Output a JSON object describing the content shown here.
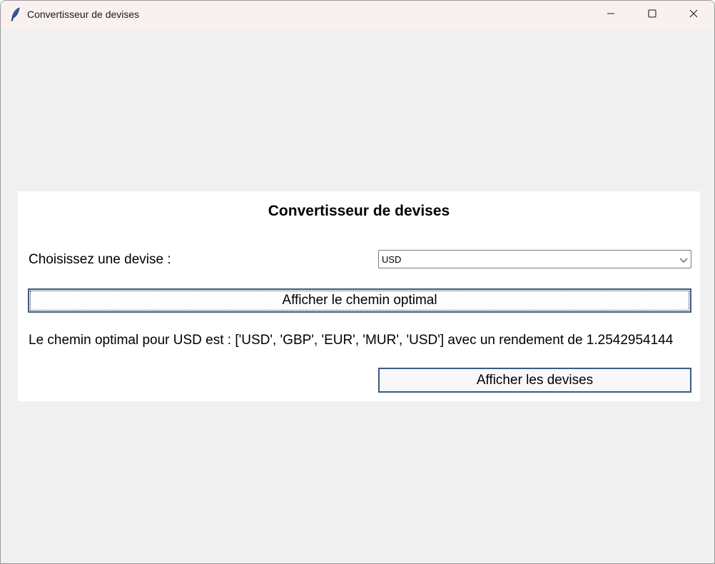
{
  "window": {
    "title": "Convertisseur de devises",
    "app_icon": "feather-icon",
    "controls": [
      "minimize-icon",
      "maximize-icon",
      "close-icon"
    ]
  },
  "main": {
    "heading": "Convertisseur de devises",
    "currency_label": "Choisissez une devise :",
    "currency_select": {
      "selected": "USD"
    },
    "optimal_button_label": "Afficher le chemin optimal",
    "result_text": "Le chemin optimal pour USD est : ['USD', 'GBP', 'EUR', 'MUR', 'USD'] avec un rendement de 1.2542954144",
    "show_currencies_button_label": "Afficher les devises"
  },
  "colors": {
    "window_bg": "#f0f0f0",
    "titlebar_bg": "#f8f1f0",
    "frame_bg": "#ffffff",
    "button_border": "#3a5b80"
  }
}
